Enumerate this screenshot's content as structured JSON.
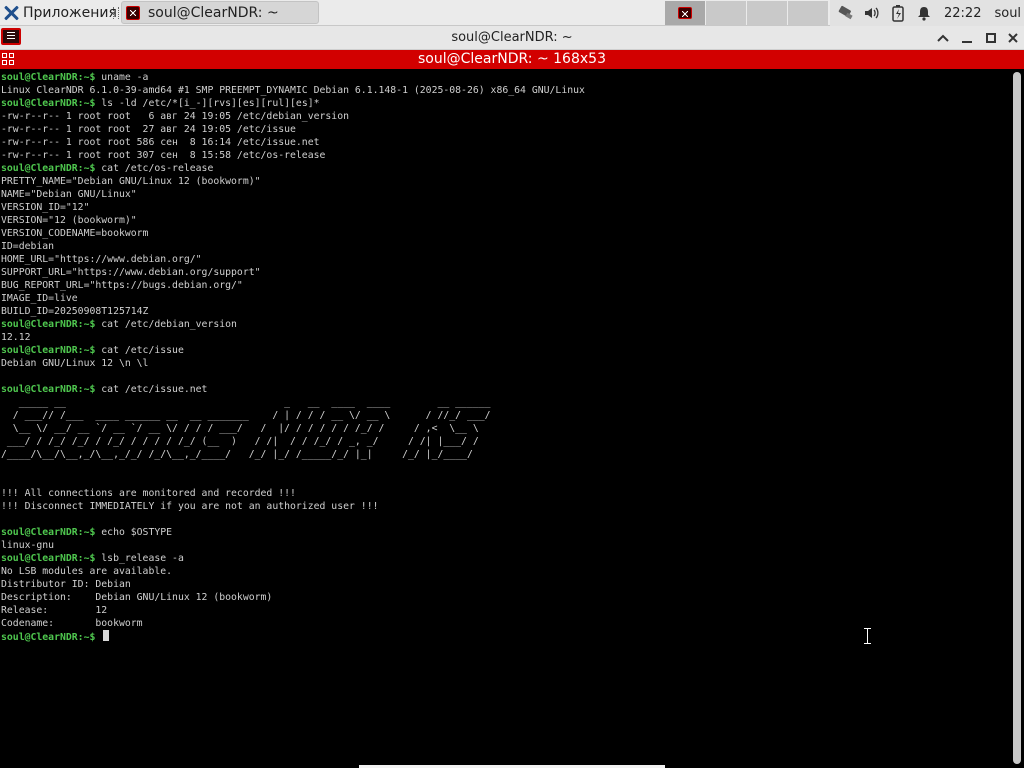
{
  "panel": {
    "apps_label": "Приложения",
    "task_title": "soul@ClearNDR: ~",
    "clock": "22:22",
    "user": "soul"
  },
  "window": {
    "title": "soul@ClearNDR: ~",
    "tab_title": "soul@ClearNDR: ~ 168x53"
  },
  "terminal": {
    "prompt": "soul@ClearNDR:~$",
    "lines": [
      {
        "prompt": "soul@ClearNDR:~$",
        "text": " uname -a"
      },
      {
        "text": "Linux ClearNDR 6.1.0-39-amd64 #1 SMP PREEMPT_DYNAMIC Debian 6.1.148-1 (2025-08-26) x86_64 GNU/Linux"
      },
      {
        "prompt": "soul@ClearNDR:~$",
        "text": " ls -ld /etc/*[i_-][rvs][es][rul][es]*"
      },
      {
        "text": "-rw-r--r-- 1 root root   6 авг 24 19:05 /etc/debian_version"
      },
      {
        "text": "-rw-r--r-- 1 root root  27 авг 24 19:05 /etc/issue"
      },
      {
        "text": "-rw-r--r-- 1 root root 586 сен  8 16:14 /etc/issue.net"
      },
      {
        "text": "-rw-r--r-- 1 root root 307 сен  8 15:58 /etc/os-release"
      },
      {
        "prompt": "soul@ClearNDR:~$",
        "text": " cat /etc/os-release"
      },
      {
        "text": "PRETTY_NAME=\"Debian GNU/Linux 12 (bookworm)\""
      },
      {
        "text": "NAME=\"Debian GNU/Linux\""
      },
      {
        "text": "VERSION_ID=\"12\""
      },
      {
        "text": "VERSION=\"12 (bookworm)\""
      },
      {
        "text": "VERSION_CODENAME=bookworm"
      },
      {
        "text": "ID=debian"
      },
      {
        "text": "HOME_URL=\"https://www.debian.org/\""
      },
      {
        "text": "SUPPORT_URL=\"https://www.debian.org/support\""
      },
      {
        "text": "BUG_REPORT_URL=\"https://bugs.debian.org/\""
      },
      {
        "text": "IMAGE_ID=live"
      },
      {
        "text": "BUILD_ID=20250908T125714Z"
      },
      {
        "prompt": "soul@ClearNDR:~$",
        "text": " cat /etc/debian_version"
      },
      {
        "text": "12.12"
      },
      {
        "prompt": "soul@ClearNDR:~$",
        "text": " cat /etc/issue"
      },
      {
        "text": "Debian GNU/Linux 12 \\n \\l"
      },
      {
        "text": ""
      },
      {
        "prompt": "soul@ClearNDR:~$",
        "text": " cat /etc/issue.net"
      },
      {
        "text": "   _____ __                                     _   __  ____  ____        __ ______"
      },
      {
        "text": "  / ___// /___  ____ ______ __  __ _______    / | / / / __ \\/ __ \\      / //_/ ___/"
      },
      {
        "text": "  \\__ \\/ __/ __ `/ __ `/ __ \\/ / / / ___/   /  |/ / / / / / /_/ /     / ,<  \\__ \\"
      },
      {
        "text": " ___/ / /_/ /_/ / /_/ / / / / /_/ (__  )   / /|  / / /_/ / _, _/     / /| |___/ /"
      },
      {
        "text": "/____/\\__/\\__,_/\\__,_/_/ /_/\\__,_/____/   /_/ |_/ /_____/_/ |_|     /_/ |_/____/"
      },
      {
        "text": ""
      },
      {
        "text": ""
      },
      {
        "text": "!!! All connections are monitored and recorded !!!"
      },
      {
        "text": "!!! Disconnect IMMEDIATELY if you are not an authorized user !!!"
      },
      {
        "text": ""
      },
      {
        "prompt": "soul@ClearNDR:~$",
        "text": " echo $OSTYPE"
      },
      {
        "text": "linux-gnu"
      },
      {
        "prompt": "soul@ClearNDR:~$",
        "text": " lsb_release -a"
      },
      {
        "text": "No LSB modules are available."
      },
      {
        "text": "Distributor ID:\tDebian"
      },
      {
        "text": "Description:\tDebian GNU/Linux 12 (bookworm)"
      },
      {
        "text": "Release:\t12"
      },
      {
        "text": "Codename:\tbookworm"
      },
      {
        "prompt": "soul@ClearNDR:~$",
        "text": " ",
        "cursor": true
      }
    ]
  },
  "icons": {
    "apps": "xfce-x-icon",
    "network": "network-icon",
    "volume": "volume-icon",
    "battery": "battery-icon",
    "notifications": "bell-icon"
  },
  "colors": {
    "tab_bar": "#d20000",
    "prompt": "#4fc84f",
    "terminal_bg": "#000000",
    "terminal_fg": "#d0d0d0"
  }
}
